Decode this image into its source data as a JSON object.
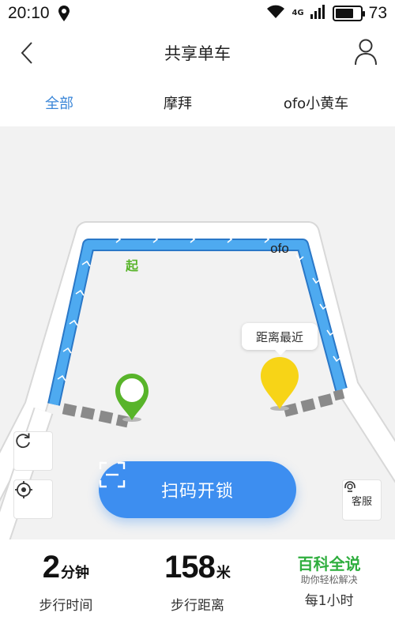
{
  "status_bar": {
    "time": "20:10",
    "network": "4G",
    "battery": "73",
    "battery_level": 0.73
  },
  "nav": {
    "title": "共享单车"
  },
  "tabs": [
    {
      "label": "全部",
      "active": true
    },
    {
      "label": "摩拜",
      "active": false
    },
    {
      "label": "ofo小黄车",
      "active": false
    }
  ],
  "map": {
    "callout": "距离最近",
    "start_marker": "起",
    "bike_marker": "ofo",
    "route_color": "#3d9be8",
    "scan_button": "扫码开锁",
    "service_label": "客服"
  },
  "stats": {
    "time_value": "2",
    "time_unit": "分钟",
    "time_label": "步行时间",
    "distance_value": "158",
    "distance_unit": "米",
    "distance_label": "步行距离",
    "watermark_title": "百科全说",
    "watermark_sub": "助你轻松解决",
    "price_label": "每1小时"
  },
  "colors": {
    "accent": "#3a86d8",
    "scan_button": "#3d8ef0",
    "ofo_yellow": "#f7d417",
    "start_green": "#58b42a"
  }
}
